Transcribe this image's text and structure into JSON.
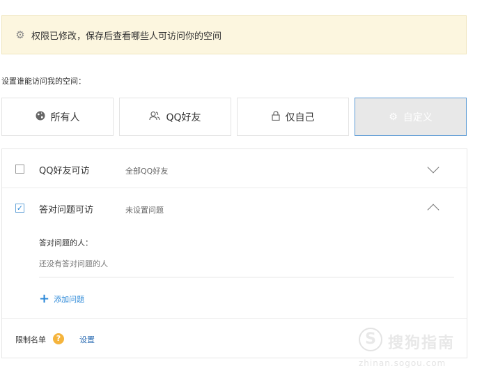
{
  "notice": {
    "icon": "gear-icon",
    "text": "权限已修改，保存后查看哪些人可访问你的空间"
  },
  "setting_label": "设置谁能访问我的空间：",
  "options": [
    {
      "label": "所有人",
      "icon": "globe-icon",
      "selected": false
    },
    {
      "label": "QQ好友",
      "icon": "friends-icon",
      "selected": false
    },
    {
      "label": "仅自己",
      "icon": "lock-icon",
      "selected": false
    },
    {
      "label": "自定义",
      "icon": "gear-icon",
      "selected": true
    }
  ],
  "rules": {
    "qq_friends": {
      "checked": false,
      "title": "QQ好友可访",
      "subtitle": "全部QQ好友",
      "expanded": false
    },
    "answer_question": {
      "checked": true,
      "title": "答对问题可访",
      "subtitle": "未设置问题",
      "expanded": true,
      "answerers_label": "答对问题的人：",
      "answerers_empty": "还没有答对问题的人",
      "add_question_label": "添加问题"
    }
  },
  "limit_list": {
    "label": "限制名单",
    "help": "?",
    "set_link": "设置"
  },
  "watermark": {
    "logo": "S",
    "text": "搜狗指南",
    "url": "zhinan.sogou.com"
  },
  "colors": {
    "accent": "#2b88d8",
    "notice_bg": "#fcf6df",
    "selected_border": "#5c9bd5",
    "help_badge": "#f5b43c"
  }
}
